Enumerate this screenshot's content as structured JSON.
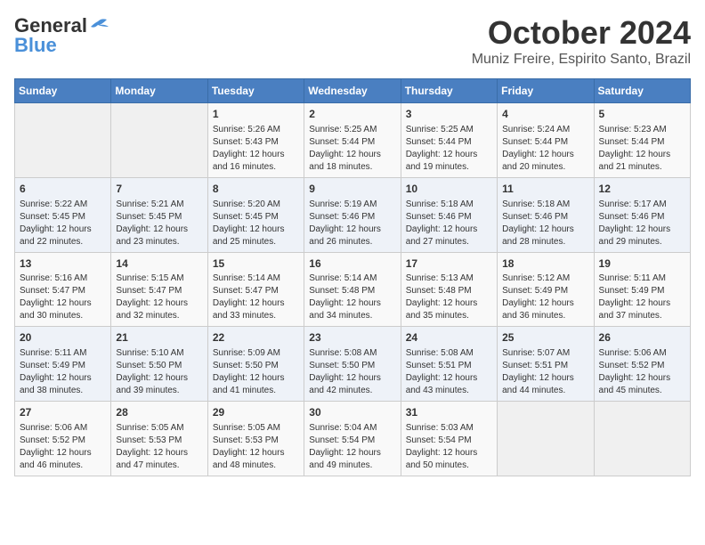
{
  "header": {
    "logo_line1": "General",
    "logo_line2": "Blue",
    "month": "October 2024",
    "location": "Muniz Freire, Espirito Santo, Brazil"
  },
  "days_of_week": [
    "Sunday",
    "Monday",
    "Tuesday",
    "Wednesday",
    "Thursday",
    "Friday",
    "Saturday"
  ],
  "weeks": [
    [
      {
        "day": "",
        "info": ""
      },
      {
        "day": "",
        "info": ""
      },
      {
        "day": "1",
        "info": "Sunrise: 5:26 AM\nSunset: 5:43 PM\nDaylight: 12 hours\nand 16 minutes."
      },
      {
        "day": "2",
        "info": "Sunrise: 5:25 AM\nSunset: 5:44 PM\nDaylight: 12 hours\nand 18 minutes."
      },
      {
        "day": "3",
        "info": "Sunrise: 5:25 AM\nSunset: 5:44 PM\nDaylight: 12 hours\nand 19 minutes."
      },
      {
        "day": "4",
        "info": "Sunrise: 5:24 AM\nSunset: 5:44 PM\nDaylight: 12 hours\nand 20 minutes."
      },
      {
        "day": "5",
        "info": "Sunrise: 5:23 AM\nSunset: 5:44 PM\nDaylight: 12 hours\nand 21 minutes."
      }
    ],
    [
      {
        "day": "6",
        "info": "Sunrise: 5:22 AM\nSunset: 5:45 PM\nDaylight: 12 hours\nand 22 minutes."
      },
      {
        "day": "7",
        "info": "Sunrise: 5:21 AM\nSunset: 5:45 PM\nDaylight: 12 hours\nand 23 minutes."
      },
      {
        "day": "8",
        "info": "Sunrise: 5:20 AM\nSunset: 5:45 PM\nDaylight: 12 hours\nand 25 minutes."
      },
      {
        "day": "9",
        "info": "Sunrise: 5:19 AM\nSunset: 5:46 PM\nDaylight: 12 hours\nand 26 minutes."
      },
      {
        "day": "10",
        "info": "Sunrise: 5:18 AM\nSunset: 5:46 PM\nDaylight: 12 hours\nand 27 minutes."
      },
      {
        "day": "11",
        "info": "Sunrise: 5:18 AM\nSunset: 5:46 PM\nDaylight: 12 hours\nand 28 minutes."
      },
      {
        "day": "12",
        "info": "Sunrise: 5:17 AM\nSunset: 5:46 PM\nDaylight: 12 hours\nand 29 minutes."
      }
    ],
    [
      {
        "day": "13",
        "info": "Sunrise: 5:16 AM\nSunset: 5:47 PM\nDaylight: 12 hours\nand 30 minutes."
      },
      {
        "day": "14",
        "info": "Sunrise: 5:15 AM\nSunset: 5:47 PM\nDaylight: 12 hours\nand 32 minutes."
      },
      {
        "day": "15",
        "info": "Sunrise: 5:14 AM\nSunset: 5:47 PM\nDaylight: 12 hours\nand 33 minutes."
      },
      {
        "day": "16",
        "info": "Sunrise: 5:14 AM\nSunset: 5:48 PM\nDaylight: 12 hours\nand 34 minutes."
      },
      {
        "day": "17",
        "info": "Sunrise: 5:13 AM\nSunset: 5:48 PM\nDaylight: 12 hours\nand 35 minutes."
      },
      {
        "day": "18",
        "info": "Sunrise: 5:12 AM\nSunset: 5:49 PM\nDaylight: 12 hours\nand 36 minutes."
      },
      {
        "day": "19",
        "info": "Sunrise: 5:11 AM\nSunset: 5:49 PM\nDaylight: 12 hours\nand 37 minutes."
      }
    ],
    [
      {
        "day": "20",
        "info": "Sunrise: 5:11 AM\nSunset: 5:49 PM\nDaylight: 12 hours\nand 38 minutes."
      },
      {
        "day": "21",
        "info": "Sunrise: 5:10 AM\nSunset: 5:50 PM\nDaylight: 12 hours\nand 39 minutes."
      },
      {
        "day": "22",
        "info": "Sunrise: 5:09 AM\nSunset: 5:50 PM\nDaylight: 12 hours\nand 41 minutes."
      },
      {
        "day": "23",
        "info": "Sunrise: 5:08 AM\nSunset: 5:50 PM\nDaylight: 12 hours\nand 42 minutes."
      },
      {
        "day": "24",
        "info": "Sunrise: 5:08 AM\nSunset: 5:51 PM\nDaylight: 12 hours\nand 43 minutes."
      },
      {
        "day": "25",
        "info": "Sunrise: 5:07 AM\nSunset: 5:51 PM\nDaylight: 12 hours\nand 44 minutes."
      },
      {
        "day": "26",
        "info": "Sunrise: 5:06 AM\nSunset: 5:52 PM\nDaylight: 12 hours\nand 45 minutes."
      }
    ],
    [
      {
        "day": "27",
        "info": "Sunrise: 5:06 AM\nSunset: 5:52 PM\nDaylight: 12 hours\nand 46 minutes."
      },
      {
        "day": "28",
        "info": "Sunrise: 5:05 AM\nSunset: 5:53 PM\nDaylight: 12 hours\nand 47 minutes."
      },
      {
        "day": "29",
        "info": "Sunrise: 5:05 AM\nSunset: 5:53 PM\nDaylight: 12 hours\nand 48 minutes."
      },
      {
        "day": "30",
        "info": "Sunrise: 5:04 AM\nSunset: 5:54 PM\nDaylight: 12 hours\nand 49 minutes."
      },
      {
        "day": "31",
        "info": "Sunrise: 5:03 AM\nSunset: 5:54 PM\nDaylight: 12 hours\nand 50 minutes."
      },
      {
        "day": "",
        "info": ""
      },
      {
        "day": "",
        "info": ""
      }
    ]
  ]
}
